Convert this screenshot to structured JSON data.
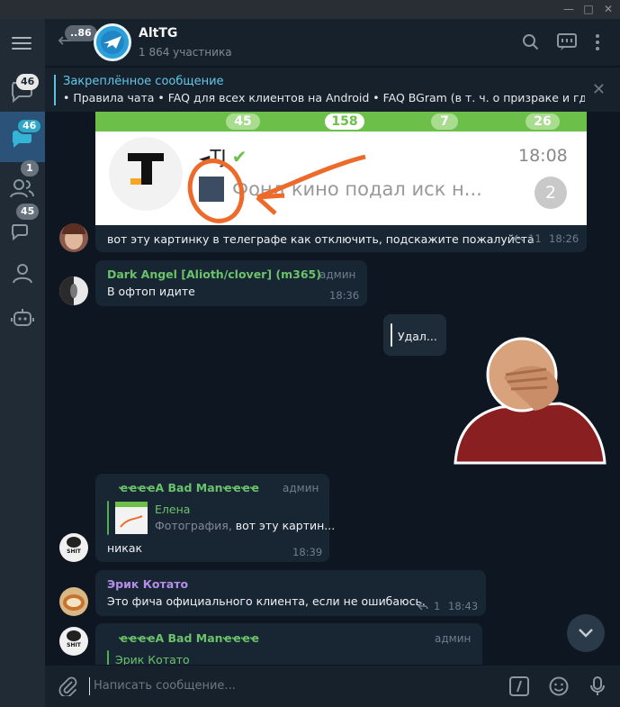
{
  "window": {
    "minimize": "—",
    "maximize": "□",
    "close": "✕"
  },
  "sidebar": {
    "folders": [
      {
        "icon": "chats-icon",
        "badge": "46",
        "active": false
      },
      {
        "icon": "chat-active-icon",
        "badge": "46",
        "active": true
      },
      {
        "icon": "contacts-icon",
        "badge": "1",
        "active": false
      },
      {
        "icon": "groups-icon",
        "badge": "45",
        "active": false
      },
      {
        "icon": "person-icon",
        "badge": "",
        "active": false
      },
      {
        "icon": "bot-icon",
        "badge": "",
        "active": false
      }
    ]
  },
  "header": {
    "back_badge": "..86",
    "title": "AltTG",
    "subtitle": "1 864 участника"
  },
  "pinned": {
    "title": "Закреплённое сообщение",
    "text": "• Правила чата  • FAQ для всех клиентов на Android   • FAQ BGram (в т. ч. о призраке и где..."
  },
  "messages": {
    "image_msg": {
      "shot_counts": [
        "45",
        "158",
        "7",
        "26"
      ],
      "shot_channel": "TJ",
      "shot_time": "18:08",
      "shot_preview": "Фонд кино подал иск н...",
      "shot_unread": "2",
      "caption": "вот эту картинку в телеграфе  как отключить, подскажите пожалуйста",
      "replies": "11",
      "time": "18:26"
    },
    "m2": {
      "sender": "Dark Angel [Alioth/clover] (m365)",
      "role": "админ",
      "text": "В офтоп идите",
      "time": "18:36"
    },
    "m3": {
      "text": "Удал..."
    },
    "m4": {
      "sender": "ҽҽҽҽA Bad Manҽҽҽҽ",
      "role": "админ",
      "reply_name": "Елена",
      "reply_prefix": "Фотография, ",
      "reply_text": "вот эту картин...",
      "text": "никак",
      "time": "18:39"
    },
    "m5": {
      "sender": "Эрик Котато",
      "text": "Это фича официального клиента, если не ошибаюсь.",
      "replies": "1",
      "time": "18:43"
    },
    "m6": {
      "sender": "ҽҽҽҽA Bad Manҽҽҽҽ",
      "role": "админ",
      "reply_name": "Эрик Котато"
    }
  },
  "input": {
    "placeholder": "Написать сообщение..."
  },
  "colors": {
    "accent": "#64c6e8",
    "bubble": "#182533",
    "bg": "#0e1621",
    "header": "#17212b",
    "green_name": "#6ac36a",
    "purple_name": "#b58ee8"
  }
}
